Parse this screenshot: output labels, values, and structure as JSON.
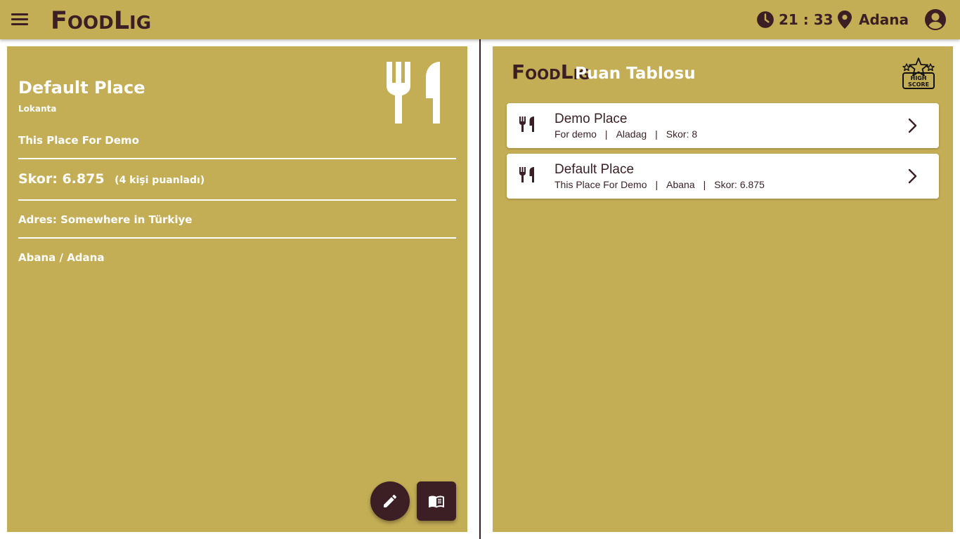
{
  "header": {
    "logo_big1": "F",
    "logo_small1": "OOD",
    "logo_big2": "L",
    "logo_small2": "IG",
    "time": "21 : 33",
    "city": "Adana",
    "icons": {
      "menu": "hamburger-icon",
      "clock": "clock-icon",
      "location": "map-pin-icon",
      "account": "account-circle-icon"
    }
  },
  "place": {
    "name": "Default Place",
    "type": "Lokanta",
    "description": "This Place For Demo",
    "score": "Skor: 6.875",
    "votes": "(4 kişi puanladı)",
    "address": "Adres: Somewhere in Türkiye",
    "location": "Abana / Adana",
    "icons": {
      "main": "cutlery-icon",
      "edit": "pencil-icon",
      "menu": "menu-book-icon"
    }
  },
  "leaderboard": {
    "title": "Puan Tablosu",
    "badge": "HIGH SCORE",
    "items": [
      {
        "name": "Demo Place",
        "description": "For demo",
        "district": "Aladag",
        "score": "Skor: 8"
      },
      {
        "name": "Default Place",
        "description": "This Place For Demo",
        "district": "Abana",
        "score": "Skor: 6.875"
      }
    ],
    "icons": {
      "item": "cutlery-icon",
      "open": "chevron-right-icon"
    }
  },
  "colors": {
    "panel": "#c4ae55",
    "accent": "#3b1f24",
    "text_light": "#ffffff",
    "background": "#ffffff"
  }
}
